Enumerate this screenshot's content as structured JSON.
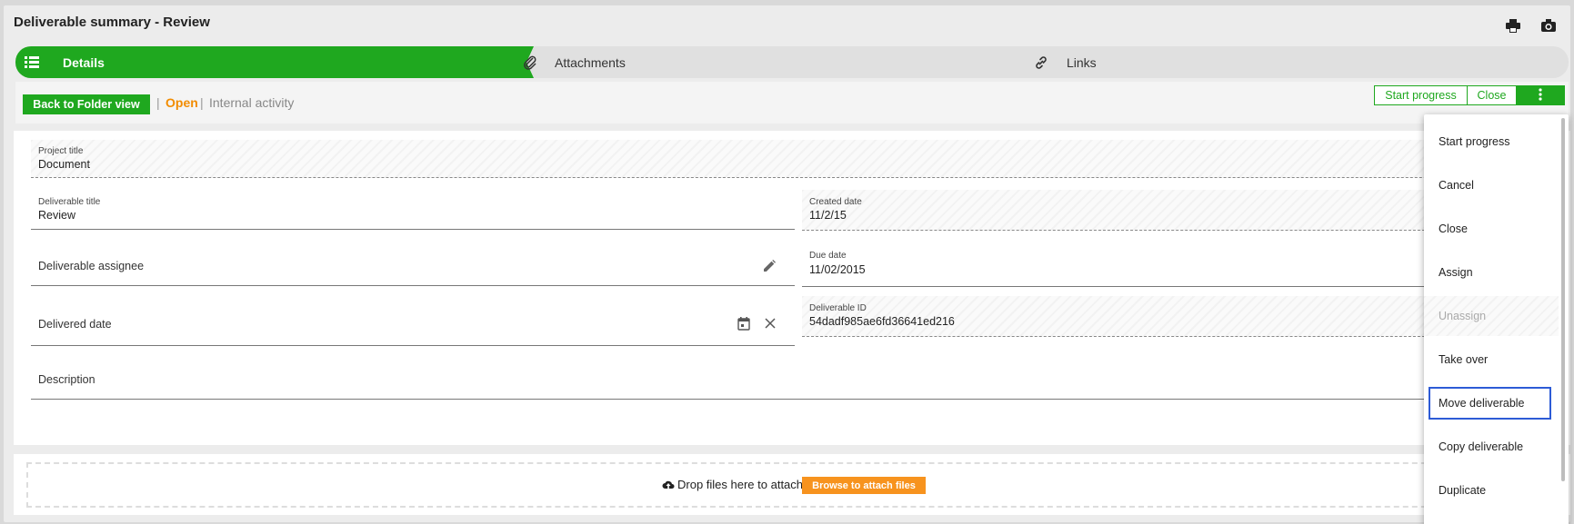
{
  "window": {
    "title": "Deliverable summary - Review",
    "icons": [
      "print-icon",
      "camera-icon"
    ]
  },
  "tabs": [
    {
      "label": "Details",
      "icon": "list-icon",
      "active": true
    },
    {
      "label": "Attachments",
      "icon": "paperclip-icon",
      "active": false
    },
    {
      "label": "Links",
      "icon": "link-icon",
      "active": false
    }
  ],
  "toolbar": {
    "back_label": "Back to Folder view",
    "separator": "|",
    "status": "Open",
    "type": "Internal activity",
    "start_progress_label": "Start progress",
    "close_label": "Close",
    "more_icon": "more-vertical-icon"
  },
  "form": {
    "project_title": {
      "label": "Project title",
      "value": "Document"
    },
    "deliverable_title": {
      "label": "Deliverable title",
      "value": "Review"
    },
    "created_date": {
      "label": "Created date",
      "value": "11/2/15"
    },
    "deliverable_assignee": {
      "placeholder": "Deliverable assignee"
    },
    "due_date": {
      "label": "Due date",
      "value": "11/02/2015"
    },
    "delivered_date": {
      "placeholder": "Delivered date"
    },
    "deliverable_id": {
      "label": "Deliverable ID",
      "value": "54dadf985ae6fd36641ed216"
    },
    "description": {
      "placeholder": "Description"
    }
  },
  "dropzone": {
    "text": "Drop files here to attach, or",
    "browse_label": "Browse to attach files"
  },
  "menu": {
    "items": [
      {
        "label": "Start progress",
        "enabled": true
      },
      {
        "label": "Cancel",
        "enabled": true
      },
      {
        "label": "Close",
        "enabled": true
      },
      {
        "label": "Assign",
        "enabled": true
      },
      {
        "label": "Unassign",
        "enabled": false
      },
      {
        "label": "Take over",
        "enabled": true
      },
      {
        "label": "Move deliverable",
        "enabled": true,
        "focused": true
      },
      {
        "label": "Copy deliverable",
        "enabled": true
      },
      {
        "label": "Duplicate",
        "enabled": true
      }
    ]
  },
  "colors": {
    "green": "#1fa81f",
    "orange": "#f28c00",
    "focus_border": "#2d5bd6"
  }
}
